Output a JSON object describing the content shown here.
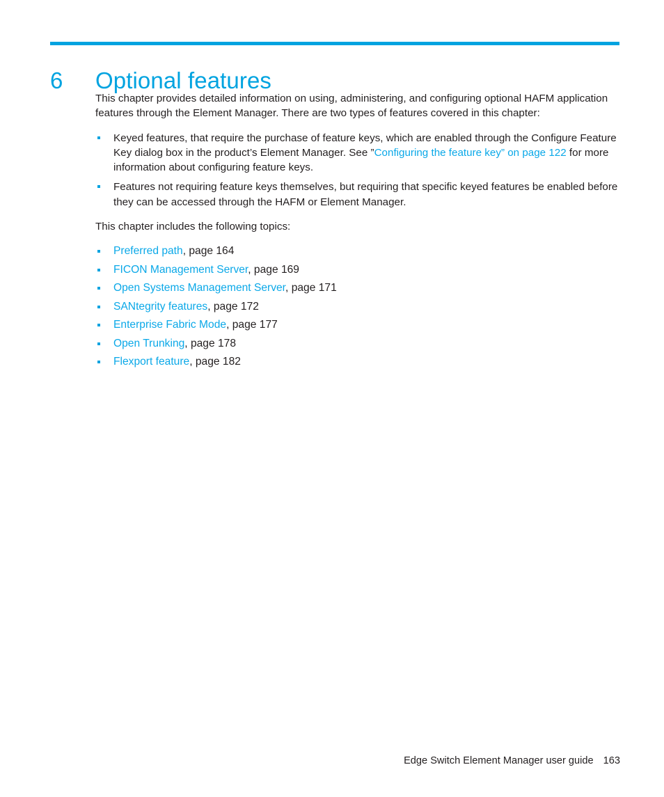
{
  "colors": {
    "accent": "#00a3e0",
    "link": "#0aa8e8",
    "text": "#231f20",
    "background": "#ffffff"
  },
  "chapter": {
    "number": "6",
    "title": "Optional features"
  },
  "intro": {
    "paragraph": "This chapter provides detailed information on using, administering, and configuring optional HAFM application features through the Element Manager. There are two types of features covered in this chapter:"
  },
  "feature_types": [
    {
      "text_before_link": "Keyed features, that require the purchase of feature keys, which are enabled through the Configure Feature Key dialog box in the product’s Element Manager. See ”",
      "link_text": "Configuring the feature key” on page 122",
      "text_after_link": " for more information about configuring feature keys."
    },
    {
      "text_before_link": "Features not requiring feature keys themselves, but requiring that specific keyed features be enabled before they can be accessed through the HAFM or Element Manager.",
      "link_text": "",
      "text_after_link": ""
    }
  ],
  "topics_intro": "This chapter includes the following topics:",
  "topics": [
    {
      "link_text": "Preferred path",
      "page_text": ", page 164"
    },
    {
      "link_text": "FICON Management Server",
      "page_text": ", page 169"
    },
    {
      "link_text": "Open Systems Management Server",
      "page_text": ", page 171"
    },
    {
      "link_text": "SANtegrity features",
      "page_text": ", page 172"
    },
    {
      "link_text": "Enterprise Fabric Mode",
      "page_text": ", page 177"
    },
    {
      "link_text": "Open Trunking",
      "page_text": ", page 178"
    },
    {
      "link_text": "Flexport feature",
      "page_text": ", page 182"
    }
  ],
  "footer": {
    "guide_name": "Edge Switch Element Manager user guide",
    "page_number": "163"
  }
}
